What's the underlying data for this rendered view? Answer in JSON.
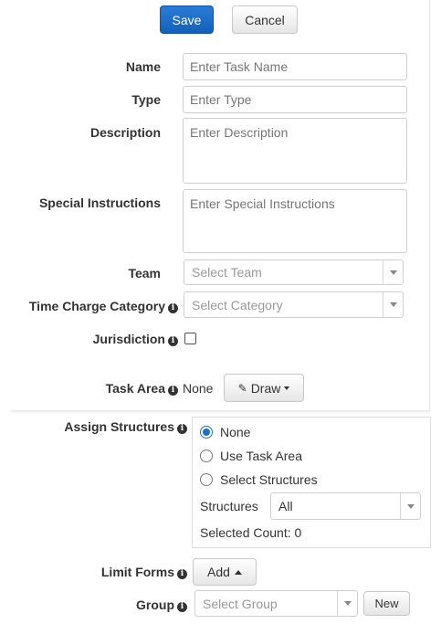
{
  "toolbar": {
    "save_label": "Save",
    "cancel_label": "Cancel"
  },
  "form": {
    "name": {
      "label": "Name",
      "placeholder": "Enter Task Name"
    },
    "type": {
      "label": "Type",
      "placeholder": "Enter Type"
    },
    "description": {
      "label": "Description",
      "placeholder": "Enter Description"
    },
    "special_instructions": {
      "label": "Special Instructions",
      "placeholder": "Enter Special Instructions"
    },
    "team": {
      "label": "Team",
      "placeholder": "Select Team"
    },
    "time_charge_category": {
      "label": "Time Charge Category",
      "placeholder": "Select Category"
    },
    "jurisdiction": {
      "label": "Jurisdiction",
      "checked": false
    },
    "task_area": {
      "label": "Task Area",
      "value": "None",
      "draw_label": "Draw"
    }
  },
  "assign_structures": {
    "label": "Assign Structures",
    "options": [
      {
        "label": "None",
        "selected": true
      },
      {
        "label": "Use Task Area",
        "selected": false
      },
      {
        "label": "Select Structures",
        "selected": false
      }
    ],
    "structures_label": "Structures",
    "structures_value": "All",
    "selected_count_label": "Selected Count: 0"
  },
  "limit_forms": {
    "label": "Limit Forms",
    "add_label": "Add"
  },
  "group": {
    "label": "Group",
    "placeholder": "Select Group",
    "new_label": "New"
  },
  "colors": {
    "primary": "#1c6fd1",
    "info_icon": "#333333"
  }
}
